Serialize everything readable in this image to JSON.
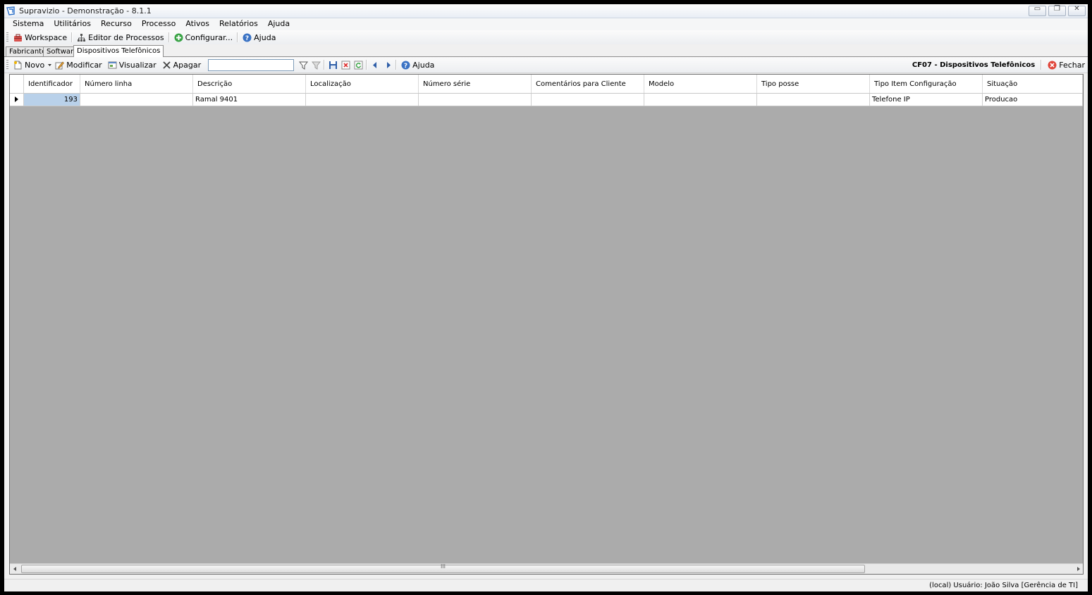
{
  "window": {
    "title": "Supravizio - Demonstração - 8.1.1",
    "buttons": {
      "minimize": "▭",
      "restore": "❐",
      "close": "✕"
    }
  },
  "menu": [
    "Sistema",
    "Utilitários",
    "Recurso",
    "Processo",
    "Ativos",
    "Relatórios",
    "Ajuda"
  ],
  "toolbar1": {
    "workspace": "Workspace",
    "process_editor": "Editor de Processos",
    "configure": "Configurar...",
    "help": "Ajuda"
  },
  "tabs": [
    "Fabricantes",
    "Software",
    "Dispositivos Telefônicos"
  ],
  "toolbar2": {
    "new": "Novo",
    "modify": "Modificar",
    "view": "Visualizar",
    "delete": "Apagar",
    "filter_value": "",
    "help": "Ajuda",
    "screen_title": "CF07 - Dispositivos Telefônicos",
    "close": "Fechar"
  },
  "grid": {
    "columns": [
      "Identificador",
      "Número linha",
      "Descrição",
      "Localização",
      "Número série",
      "Comentários para Cliente",
      "Modelo",
      "Tipo posse",
      "Tipo Item Configuração",
      "Situação"
    ],
    "rows": [
      [
        "193",
        "",
        "Ramal 9401",
        "",
        "",
        "",
        "",
        "",
        "Telefone IP",
        "Producao"
      ]
    ]
  },
  "scroll_grip": "III",
  "status": {
    "text": "(local)  Usuário: João Silva [Gerência de TI]"
  },
  "colors": {
    "accent": "#2a6fc9",
    "selected_cell": "#b9d1ea",
    "grid_bg": "#ababab"
  }
}
